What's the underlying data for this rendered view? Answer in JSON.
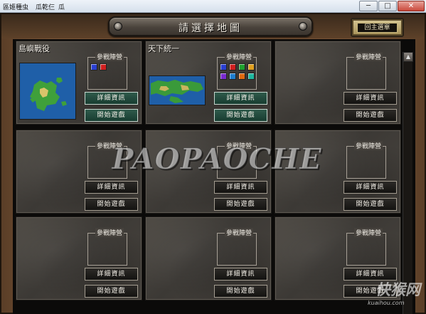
{
  "window": {
    "menu": [
      "區姬種虫",
      "瓜乾仨",
      "瓜"
    ],
    "controls": [
      "─",
      "□",
      "✕"
    ]
  },
  "header": {
    "title": "請選擇地圖",
    "main_menu_label": "回主選單"
  },
  "camp_label": "參戰陣營",
  "detail_label": "詳細資訊",
  "start_label": "開始遊戲",
  "maps": [
    {
      "name": "島嶼戰役",
      "thumbnail": "island-map",
      "factions": [
        "#2a3fd0",
        "#d11f1f"
      ],
      "active": true
    },
    {
      "name": "天下統一",
      "thumbnail": "world-map",
      "factions": [
        "#2a3fd0",
        "#d11f1f",
        "#1ea02d",
        "#e0a020",
        "#7a2ad0",
        "#1f7fd0",
        "#e06a10",
        "#20b8a0"
      ],
      "active": true
    },
    {
      "name": "",
      "thumbnail": "",
      "factions": [],
      "active": false
    },
    {
      "name": "",
      "thumbnail": "",
      "factions": [],
      "active": false
    },
    {
      "name": "",
      "thumbnail": "",
      "factions": [],
      "active": false
    },
    {
      "name": "",
      "thumbnail": "",
      "factions": [],
      "active": false
    },
    {
      "name": "",
      "thumbnail": "",
      "factions": [],
      "active": false
    },
    {
      "name": "",
      "thumbnail": "",
      "factions": [],
      "active": false
    },
    {
      "name": "",
      "thumbnail": "",
      "factions": [],
      "active": false
    }
  ],
  "scroll_up_icon": "▲",
  "watermark": {
    "text": "PAOPAOCHE",
    "site_logo": "快猴网",
    "site_url": "kuaihou.com"
  }
}
